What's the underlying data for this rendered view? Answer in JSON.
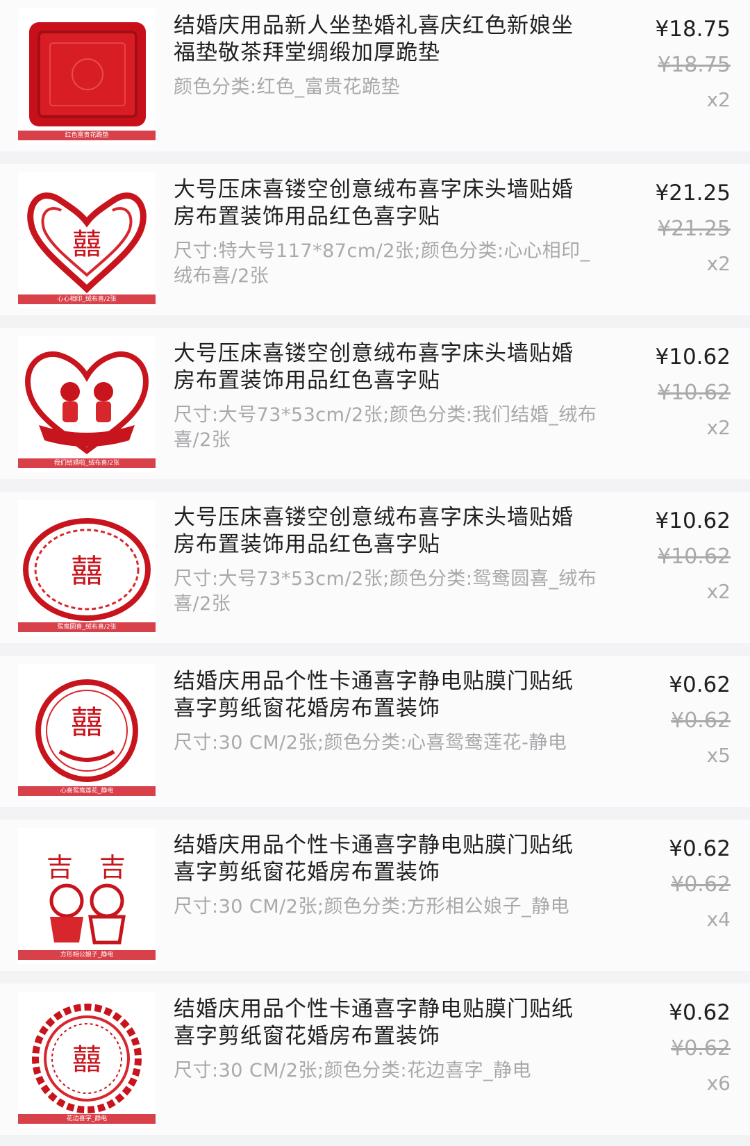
{
  "items": [
    {
      "title": "结婚庆用品新人坐垫婚礼喜庆红色新娘坐福垫敬茶拜堂绸缎加厚跪垫",
      "spec": "颜色分类:红色_富贵花跪垫",
      "price": "¥18.75",
      "original_price": "¥18.75",
      "quantity": "x2",
      "thumb_label": "红色富贵花跪垫",
      "thumb_icon": "cushion-icon"
    },
    {
      "title": "大号压床喜镂空创意绒布喜字床头墙贴婚房布置装饰用品红色喜字贴",
      "spec": "尺寸:特大号117*87cm/2张;颜色分类:心心相印_绒布喜/2张",
      "price": "¥21.25",
      "original_price": "¥21.25",
      "quantity": "x2",
      "thumb_label": "心心相印_绒布喜/2张",
      "thumb_icon": "double-heart-papercut-icon"
    },
    {
      "title": "大号压床喜镂空创意绒布喜字床头墙贴婚房布置装饰用品红色喜字贴",
      "spec": "尺寸:大号73*53cm/2张;颜色分类:我们结婚_绒布喜/2张",
      "price": "¥10.62",
      "original_price": "¥10.62",
      "quantity": "x2",
      "thumb_label": "我们结婚啦_绒布喜/2张",
      "thumb_icon": "heart-couple-papercut-icon"
    },
    {
      "title": "大号压床喜镂空创意绒布喜字床头墙贴婚房布置装饰用品红色喜字贴",
      "spec": "尺寸:大号73*53cm/2张;颜色分类:鸳鸯圆喜_绒布喜/2张",
      "price": "¥10.62",
      "original_price": "¥10.62",
      "quantity": "x2",
      "thumb_label": "鸳鸯圆喜_绒布喜/2张",
      "thumb_icon": "oval-xi-papercut-icon"
    },
    {
      "title": "结婚庆用品个性卡通喜字静电贴膜门贴纸喜字剪纸窗花婚房布置装饰",
      "spec": "尺寸:30 CM/2张;颜色分类:心喜鸳鸯莲花-静电",
      "price": "¥0.62",
      "original_price": "¥0.62",
      "quantity": "x5",
      "thumb_label": "心喜鸳鸯莲花_静电",
      "thumb_icon": "round-xi-papercut-icon"
    },
    {
      "title": "结婚庆用品个性卡通喜字静电贴膜门贴纸喜字剪纸窗花婚房布置装饰",
      "spec": "尺寸:30 CM/2张;颜色分类:方形相公娘子_静电",
      "price": "¥0.62",
      "original_price": "¥0.62",
      "quantity": "x4",
      "thumb_label": "方形相公娘子_静电",
      "thumb_icon": "cartoon-couple-papercut-icon"
    },
    {
      "title": "结婚庆用品个性卡通喜字静电贴膜门贴纸喜字剪纸窗花婚房布置装饰",
      "spec": "尺寸:30 CM/2张;颜色分类:花边喜字_静电",
      "price": "¥0.62",
      "original_price": "¥0.62",
      "quantity": "x6",
      "thumb_label": "花边喜字_静电",
      "thumb_icon": "lace-xi-papercut-icon"
    }
  ],
  "colors": {
    "accent_red": "#d8232a",
    "text_primary": "#1f1f1f",
    "text_secondary": "#a9a9ab"
  }
}
